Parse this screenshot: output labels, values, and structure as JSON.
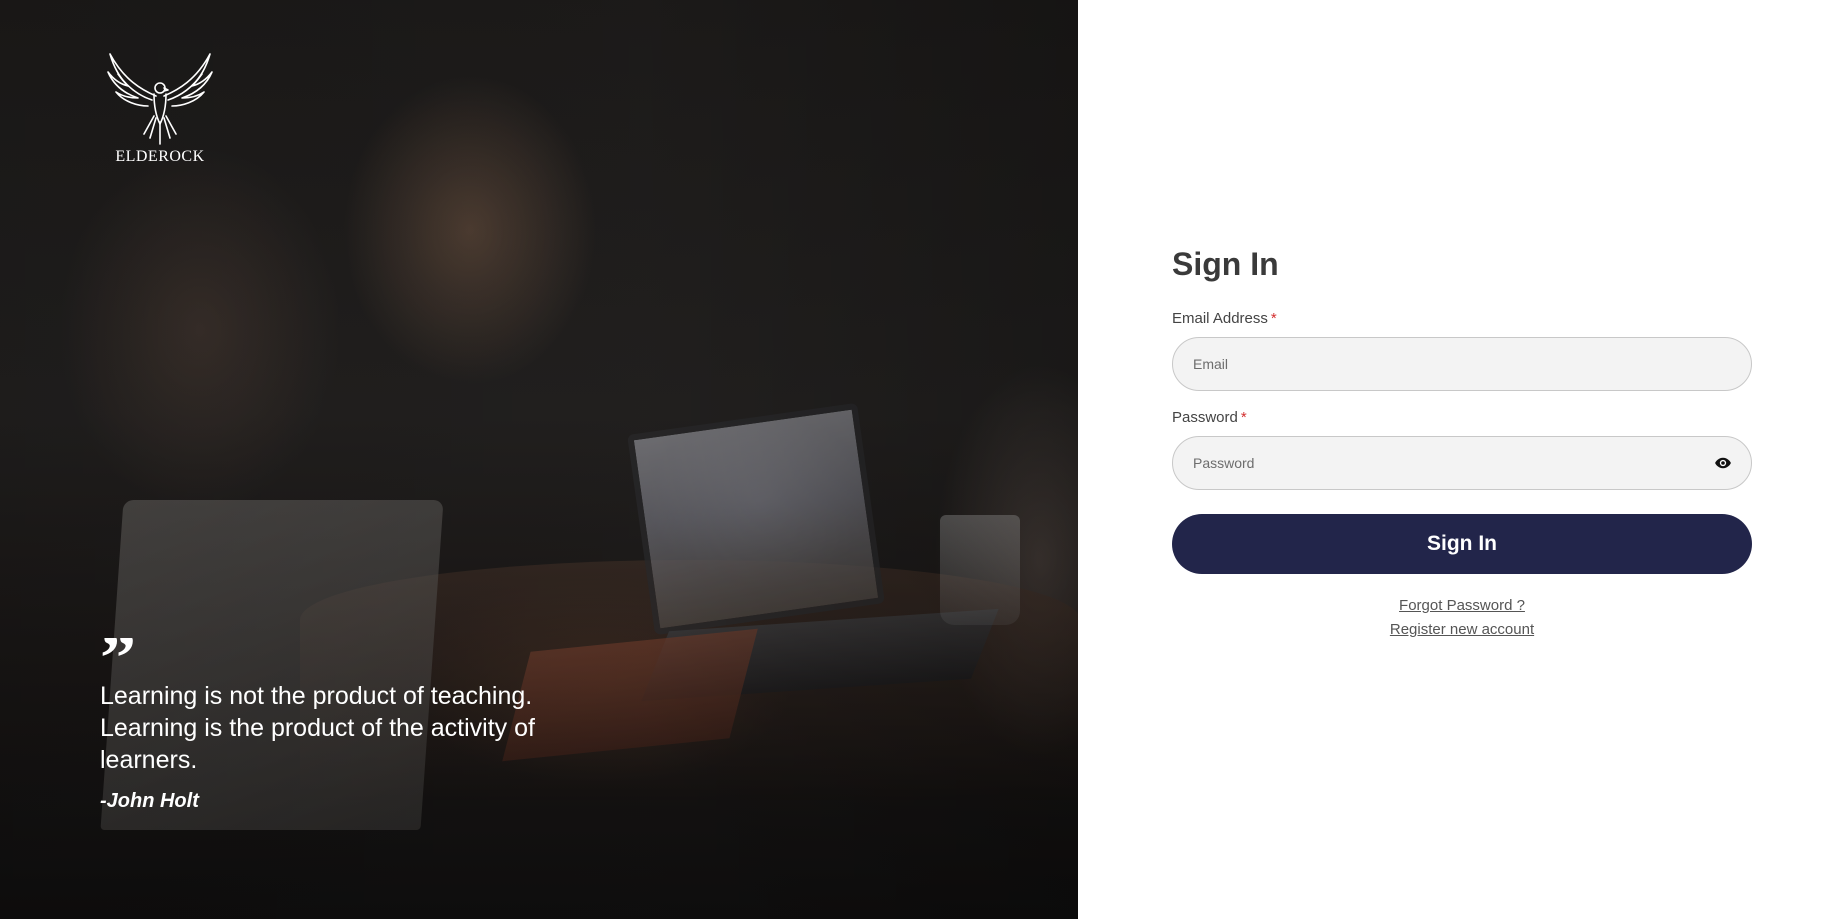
{
  "brand": {
    "logo_icon": "eagle-icon",
    "name": "ELDEROCK"
  },
  "quote": {
    "mark": "”",
    "text": "Learning is not the product of teaching. Learning is the product of the activity of learners.",
    "author": "-John Holt"
  },
  "signin": {
    "title": "Sign In",
    "email": {
      "label": "Email Address",
      "required_mark": "*",
      "placeholder": "Email",
      "value": ""
    },
    "password": {
      "label": "Password",
      "required_mark": "*",
      "placeholder": "Password",
      "value": "",
      "toggle_icon": "eye-icon"
    },
    "submit_label": "Sign In",
    "forgot_label": "Forgot Password ?",
    "register_label": "Register new account"
  },
  "colors": {
    "primary_button": "#22254a",
    "required": "#d32f2f",
    "input_bg": "#f3f3f3"
  }
}
